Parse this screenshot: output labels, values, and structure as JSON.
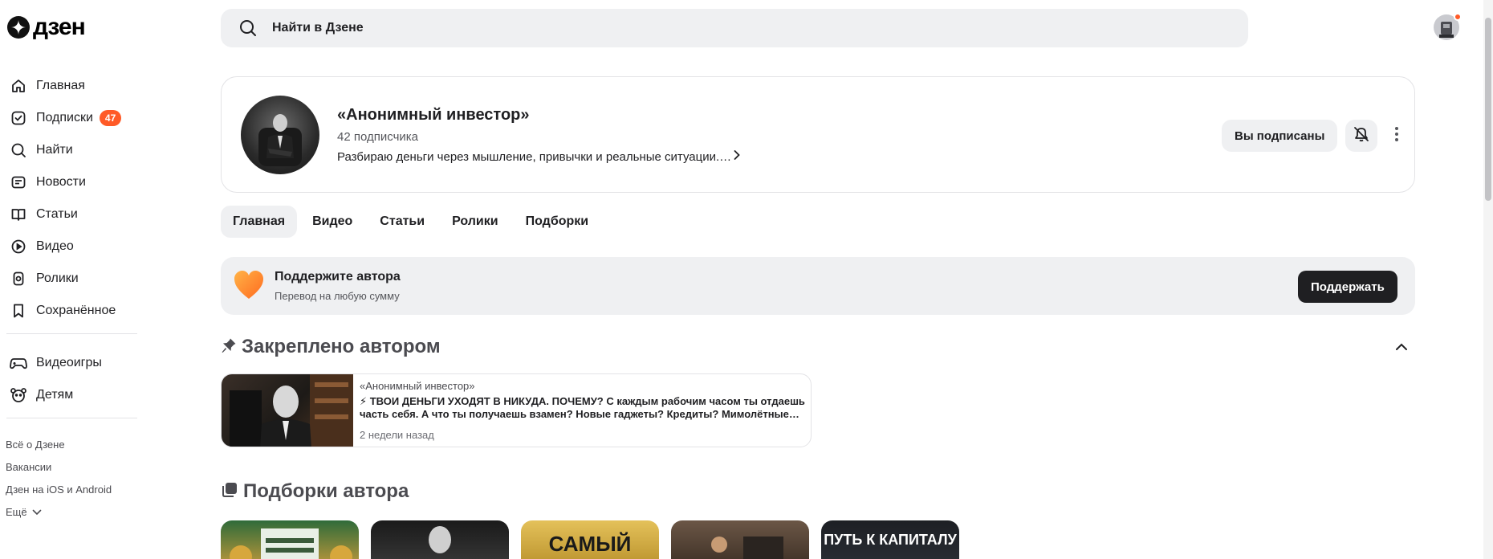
{
  "logo": {
    "text": "дзен"
  },
  "search": {
    "placeholder": "Найти в Дзене"
  },
  "sidebar": {
    "items": [
      {
        "label": "Главная",
        "icon": "home-icon"
      },
      {
        "label": "Подписки",
        "icon": "subscriptions-icon",
        "badge": "47"
      },
      {
        "label": "Найти",
        "icon": "search-icon"
      },
      {
        "label": "Новости",
        "icon": "news-icon"
      },
      {
        "label": "Статьи",
        "icon": "articles-icon"
      },
      {
        "label": "Видео",
        "icon": "video-icon"
      },
      {
        "label": "Ролики",
        "icon": "shorts-icon"
      },
      {
        "label": "Сохранённое",
        "icon": "bookmark-icon"
      }
    ],
    "items2": [
      {
        "label": "Видеоигры",
        "icon": "gamepad-icon"
      },
      {
        "label": "Детям",
        "icon": "kids-icon"
      }
    ],
    "footer": [
      "Всё о Дзене",
      "Вакансии",
      "Дзен на iOS и Android",
      "Ещё"
    ]
  },
  "channel": {
    "title": "«Анонимный инвестор»",
    "subscribers": "42 подписчика",
    "description": "Разбираю деньги через мышление, привычки и реальные ситуации.…",
    "subscribed_label": "Вы подписаны"
  },
  "tabs": [
    "Главная",
    "Видео",
    "Статьи",
    "Ролики",
    "Подборки"
  ],
  "support": {
    "title": "Поддержите автора",
    "subtitle": "Перевод на любую сумму",
    "button": "Поддержать"
  },
  "pinned": {
    "section_title": "Закреплено автором",
    "author": "«Анонимный инвестор»",
    "text": "⚡ ТВОИ ДЕНЬГИ УХОДЯТ В НИКУДА. ПОЧЕМУ? С каждым рабочим часом ты отдаешь часть себя. А что ты получаешь взамен? Новые гаджеты? Кредиты? Мимолётные…",
    "time": "2 недели назад"
  },
  "collections": {
    "section_title": "Подборки автора",
    "items": [
      {
        "label": ""
      },
      {
        "label": ""
      },
      {
        "label": "САМЫЙ"
      },
      {
        "label": ""
      },
      {
        "label": "ПУТЬ К КАПИТАЛУ"
      }
    ]
  },
  "colors": {
    "accent": "#ff5a27",
    "surface": "#eff0f2",
    "dark_button": "#1f1f22"
  }
}
